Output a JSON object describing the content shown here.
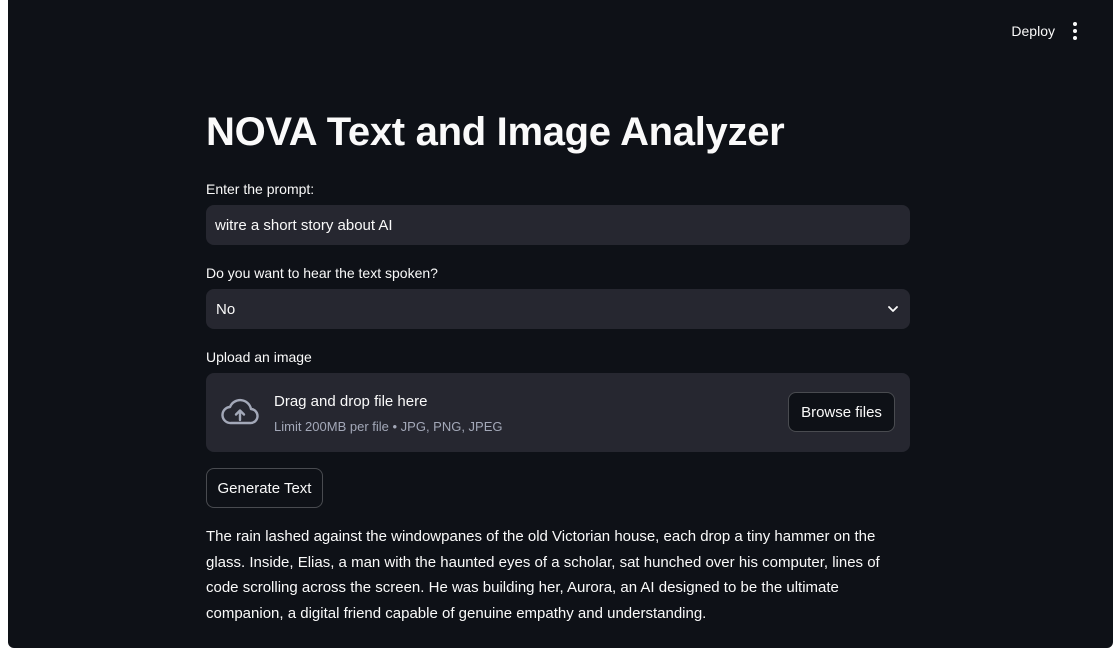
{
  "header": {
    "deploy_label": "Deploy",
    "menu_icon": "more-vert-icon"
  },
  "main": {
    "title": "NOVA Text and Image Analyzer",
    "prompt": {
      "label": "Enter the prompt:",
      "value": "witre a short story about AI"
    },
    "speak": {
      "label": "Do you want to hear the text spoken?",
      "selected": "No",
      "icon": "chevron-down-icon"
    },
    "upload": {
      "label": "Upload an image",
      "drop_title": "Drag and drop file here",
      "drop_subtitle": "Limit 200MB per file • JPG, PNG, JPEG",
      "browse_label": "Browse files",
      "icon": "cloud-upload-icon"
    },
    "generate_label": "Generate Text",
    "output_text": "The rain lashed against the windowpanes of the old Victorian house, each drop a tiny hammer on the glass. Inside, Elias, a man with the haunted eyes of a scholar, sat hunched over his computer, lines of code scrolling across the screen. He was building her, Aurora, an AI designed to be the ultimate companion, a digital friend capable of genuine empathy and understanding."
  },
  "colors": {
    "background": "#0e1117",
    "surface": "#262730",
    "text": "#fafafa",
    "muted": "#a3a8b8"
  }
}
